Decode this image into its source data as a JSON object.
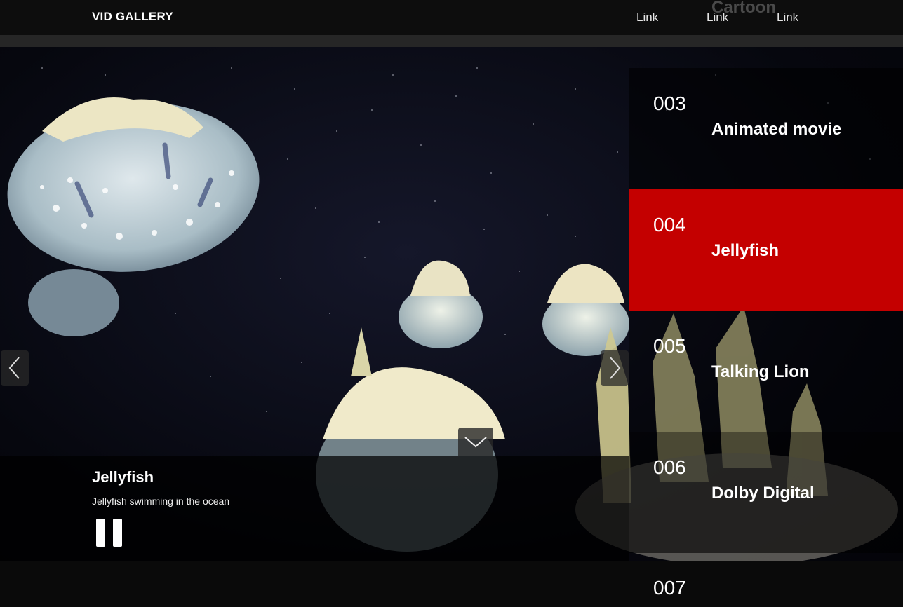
{
  "nav": {
    "brand": "VID GALLERY",
    "links": [
      "Link",
      "Link",
      "Link"
    ],
    "ghost_text": "Cartoon"
  },
  "player": {
    "title": "Jellyfish",
    "description": "Jellyfish swimming in the ocean",
    "prev_icon": "chevron-left-icon",
    "next_icon": "chevron-right-icon",
    "collapse_icon": "chevron-down-icon",
    "pause_icon": "pause-icon"
  },
  "playlist": {
    "active_color": "#c40000",
    "items": [
      {
        "number": "003",
        "title": "Animated movie",
        "active": false
      },
      {
        "number": "004",
        "title": "Jellyfish",
        "active": true
      },
      {
        "number": "005",
        "title": "Talking Lion",
        "active": false
      },
      {
        "number": "006",
        "title": "Dolby Digital",
        "active": false
      },
      {
        "number": "007",
        "title": "",
        "active": false
      }
    ]
  }
}
